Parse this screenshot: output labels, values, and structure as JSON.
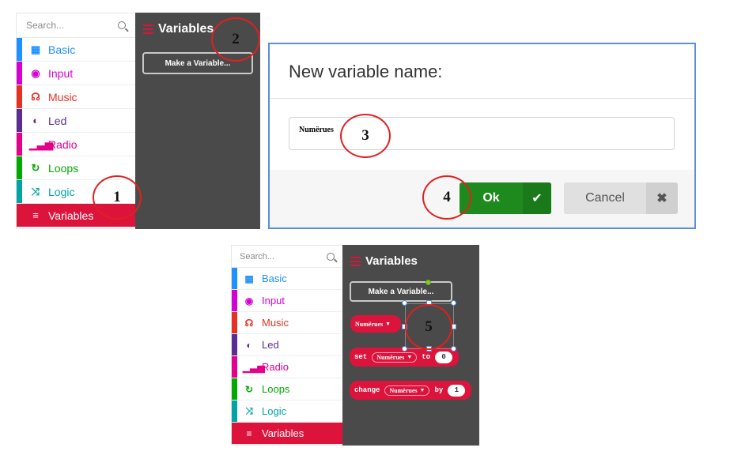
{
  "search": {
    "placeholder": "Search..."
  },
  "categories": [
    {
      "label": "Basic",
      "icon": "grid-icon",
      "glyph": "▦",
      "color": "#1e90ff"
    },
    {
      "label": "Input",
      "icon": "target-icon",
      "glyph": "◉",
      "color": "#d400d4"
    },
    {
      "label": "Music",
      "icon": "headphones-icon",
      "glyph": "☊",
      "color": "#e63022"
    },
    {
      "label": "Led",
      "icon": "toggle-icon",
      "glyph": "◐",
      "color": "#5c2d91"
    },
    {
      "label": "Radio",
      "icon": "signal-bars-icon",
      "glyph": "▁▃▅",
      "color": "#e3008c"
    },
    {
      "label": "Loops",
      "icon": "loop-arrow-icon",
      "glyph": "↻",
      "color": "#00aa00"
    },
    {
      "label": "Logic",
      "icon": "shuffle-icon",
      "glyph": "⤨",
      "color": "#00a4a6"
    },
    {
      "label": "Variables",
      "icon": "list-icon",
      "glyph": "≡",
      "color": "#dc143c"
    }
  ],
  "flyout": {
    "title": "Variables",
    "make_variable": "Make a Variable..."
  },
  "dialog": {
    "title": "New variable name:",
    "input_value": "Numërues",
    "ok_label": "Ok",
    "cancel_label": "Cancel",
    "ok_color": "#1e8a1e"
  },
  "markers": [
    "1",
    "2",
    "3",
    "4",
    "5"
  ],
  "blocks": {
    "variable_name": "Numërues",
    "set_label": "set",
    "to_label": "to",
    "set_value": "0",
    "change_label": "change",
    "by_label": "by",
    "change_value": "1"
  },
  "colors": {
    "accent": "#dc143c",
    "flyout_bg": "#4a4a4a",
    "marker": "#e02020",
    "dialog_border": "#5a8fd6"
  }
}
